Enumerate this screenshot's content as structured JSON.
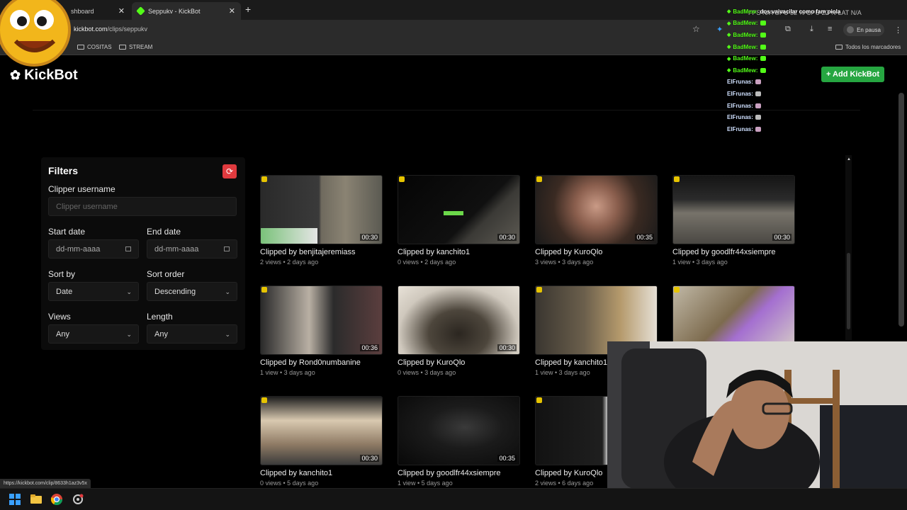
{
  "browser": {
    "tabs": [
      {
        "title": "shboard",
        "active": false
      },
      {
        "title": "Seppukv - KickBot",
        "active": true
      }
    ],
    "new_tab": "+",
    "url_host": "kickbot.com",
    "url_path": "/clips/seppukv",
    "profile_label": "En pausa",
    "bookmarks": [
      "COSITAS",
      "STREAM"
    ],
    "all_bookmarks": "Todos los marcadores",
    "status_url": "https://kickbot.com/clip/8633h1az3v5x"
  },
  "page": {
    "logo": "KickBot",
    "add_button": "+ Add KickBot",
    "accent": "#26a641",
    "filters": {
      "title": "Filters",
      "clipper_label": "Clipper username",
      "clipper_placeholder": "Clipper username",
      "start_label": "Start date",
      "start_value": "dd-mm-aaaa",
      "end_label": "End date",
      "end_value": "dd-mm-aaaa",
      "sort_by_label": "Sort by",
      "sort_by_value": "Date",
      "sort_order_label": "Sort order",
      "sort_order_value": "Descending",
      "views_label": "Views",
      "views_value": "Any",
      "length_label": "Length",
      "length_value": "Any"
    },
    "clips": [
      {
        "title": "Clipped by benjitajeremiass",
        "meta": "2 views • 2 days ago",
        "duration": "00:30"
      },
      {
        "title": "Clipped by kanchito1",
        "meta": "0 views • 2 days ago",
        "duration": "00:30"
      },
      {
        "title": "Clipped by KuroQlo",
        "meta": "3 views • 3 days ago",
        "duration": "00:35"
      },
      {
        "title": "Clipped by goodlfr44xsiempre",
        "meta": "1 view • 3 days ago",
        "duration": "00:30"
      },
      {
        "title": "Clipped by Rond0numbanine",
        "meta": "1 view • 3 days ago",
        "duration": "00:36"
      },
      {
        "title": "Clipped by KuroQlo",
        "meta": "0 views • 3 days ago",
        "duration": "00:30"
      },
      {
        "title": "Clipped by kanchito1",
        "meta": "1 view • 3 days ago",
        "duration": ""
      },
      {
        "title": "",
        "meta": "",
        "duration": ""
      },
      {
        "title": "Clipped by kanchito1",
        "meta": "0 views • 5 days ago",
        "duration": "00:30"
      },
      {
        "title": "Clipped by goodlfr44xsiempre",
        "meta": "1 view • 5 days ago",
        "duration": "00:35"
      },
      {
        "title": "Clipped by KuroQlo",
        "meta": "2 views • 6 days ago",
        "duration": ""
      }
    ]
  },
  "overlay": {
    "stats": "FPS N/A   GPU 32 %   CPU 22 %   LAT N/A",
    "chat": [
      {
        "user": "BadMew:",
        "msg": "dos vaivacilar como fam piola",
        "kind": "badmew"
      },
      {
        "user": "BadMew:",
        "msg": "",
        "kind": "badmew"
      },
      {
        "user": "BadMew:",
        "msg": "",
        "kind": "badmew"
      },
      {
        "user": "BadMew:",
        "msg": "",
        "kind": "badmew"
      },
      {
        "user": "BadMew:",
        "msg": "",
        "kind": "badmew"
      },
      {
        "user": "BadMew:",
        "msg": "",
        "kind": "badmew"
      },
      {
        "user": "ElFrunas:",
        "msg": "",
        "kind": "elfrunas"
      },
      {
        "user": "ElFrunas:",
        "msg": "",
        "kind": "elfrunas"
      },
      {
        "user": "ElFrunas:",
        "msg": "",
        "kind": "elfrunas"
      },
      {
        "user": "ElFrunas:",
        "msg": "",
        "kind": "elfrunas"
      },
      {
        "user": "ElFrunas:",
        "msg": "",
        "kind": "elfrunas"
      }
    ]
  }
}
